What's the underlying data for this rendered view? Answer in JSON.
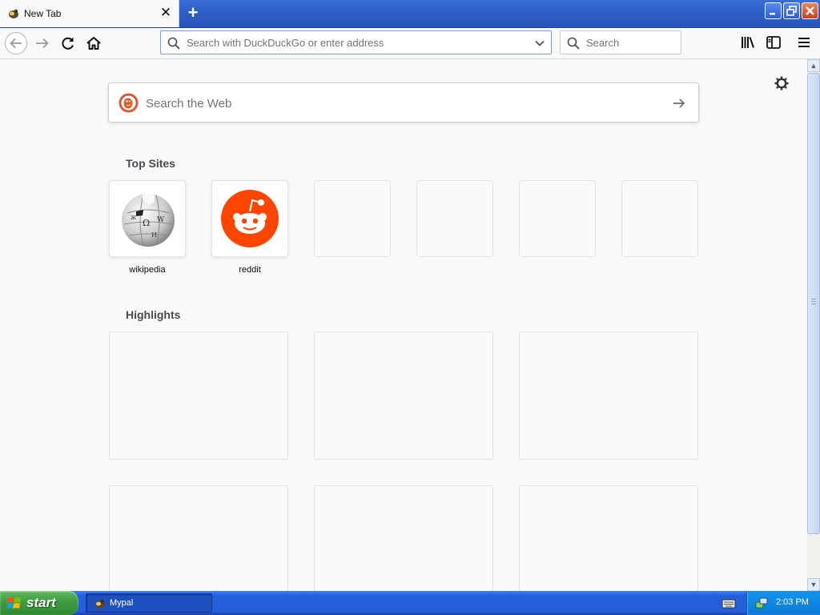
{
  "tab": {
    "title": "New Tab",
    "close": "✕",
    "new_tab": "+"
  },
  "window_controls": {
    "minimize": "_",
    "maximize": "❐",
    "close": "✕"
  },
  "urlbar": {
    "placeholder": "Search with DuckDuckGo or enter address",
    "value": ""
  },
  "searchbar": {
    "placeholder": "Search",
    "value": ""
  },
  "newtab": {
    "web_search_placeholder": "Search the Web",
    "top_sites_title": "Top Sites",
    "top_sites": [
      {
        "label": "wikipedia",
        "icon": "wikipedia-globe-icon"
      },
      {
        "label": "reddit",
        "icon": "reddit-alien-icon"
      },
      {
        "label": ""
      },
      {
        "label": ""
      },
      {
        "label": ""
      },
      {
        "label": ""
      }
    ],
    "highlights_title": "Highlights"
  },
  "taskbar": {
    "start_label": "start",
    "task_label": "Mypal",
    "clock": "2:03 PM"
  },
  "colors": {
    "reddit": "#ff4500",
    "ddg": "#de5833",
    "xp_blue": "#245edb",
    "xp_green": "#3c9a3e"
  }
}
